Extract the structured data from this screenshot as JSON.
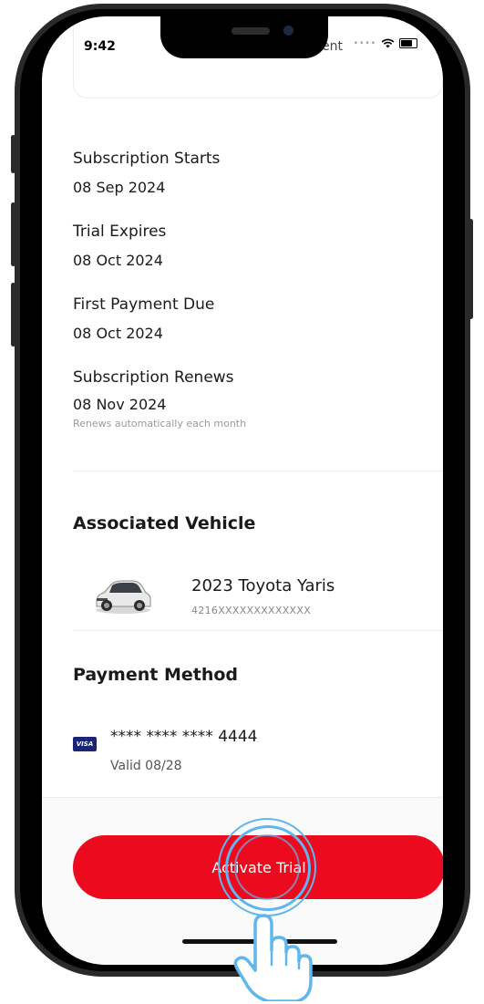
{
  "status_bar": {
    "time": "9:42"
  },
  "plan_card": {
    "note": "No long-term commitment"
  },
  "schedule": [
    {
      "label": "Subscription Starts",
      "date": "08 Sep 2024"
    },
    {
      "label": "Trial Expires",
      "date": "08 Oct 2024"
    },
    {
      "label": "First Payment Due",
      "date": "08 Oct 2024"
    },
    {
      "label": "Subscription Renews",
      "date": "08 Nov 2024",
      "note": "Renews automatically each month"
    }
  ],
  "vehicle": {
    "section_title": "Associated Vehicle",
    "name": "2023 Toyota Yaris",
    "vin": "4216XXXXXXXXXXXXX"
  },
  "payment": {
    "section_title": "Payment Method",
    "card_brand": "VISA",
    "card_number": "**** **** **** 4444",
    "valid": "Valid 08/28"
  },
  "cta": {
    "label": "Activate Trial"
  },
  "colors": {
    "accent": "#ec0a1e",
    "visa": "#1a2477"
  },
  "icons": {
    "wifi": "wifi-icon",
    "battery": "battery-icon",
    "car": "car-image",
    "card": "visa-card-icon",
    "hand": "tap-hand-icon"
  }
}
